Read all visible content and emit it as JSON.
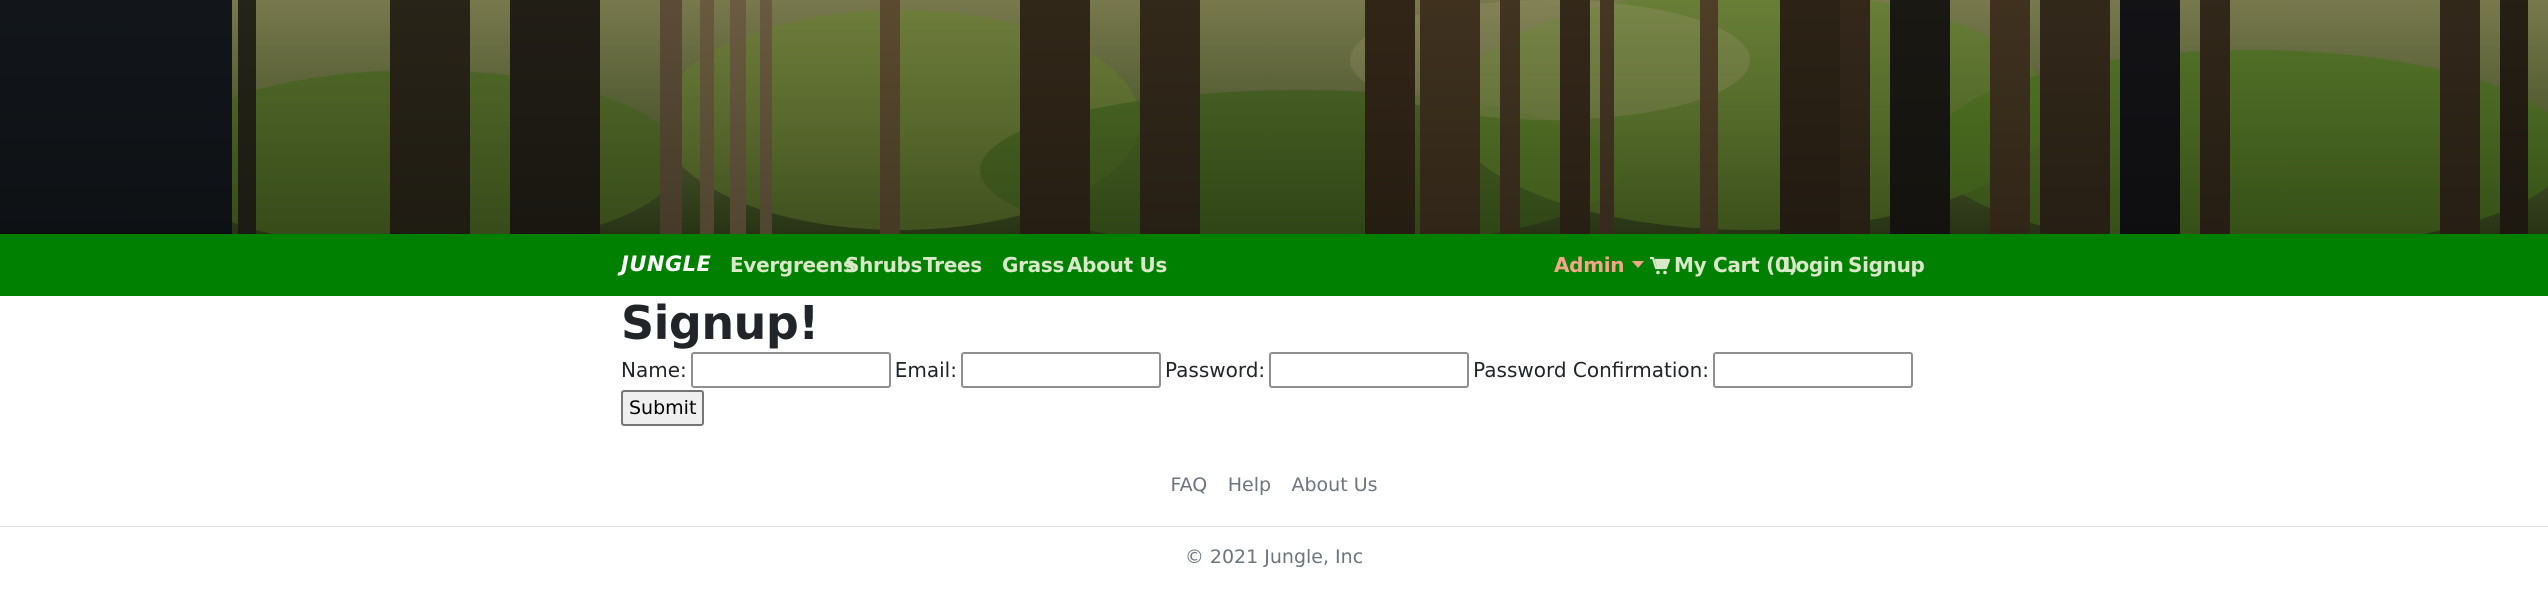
{
  "navbar": {
    "brand": "JUNGLE",
    "links": [
      "Evergreens",
      "Shrubs",
      "Trees",
      "Grass",
      "About Us"
    ],
    "admin_label": "Admin",
    "cart_label": "My Cart (0)",
    "login_label": "Login",
    "signup_label": "Signup",
    "background_color": "#008000"
  },
  "signup": {
    "title": "Signup!",
    "name_label": "Name:",
    "name_value": "",
    "email_label": "Email:",
    "email_value": "",
    "password_label": "Password:",
    "password_value": "",
    "password_confirmation_label": "Password Confirmation:",
    "password_confirmation_value": "",
    "submit_label": "Submit"
  },
  "footer": {
    "links": [
      "FAQ",
      "Help",
      "About Us"
    ],
    "copyright": "© 2021 Jungle, Inc"
  },
  "icons": {
    "cart": "shopping-cart-icon",
    "admin_caret": "caret-down-icon"
  }
}
